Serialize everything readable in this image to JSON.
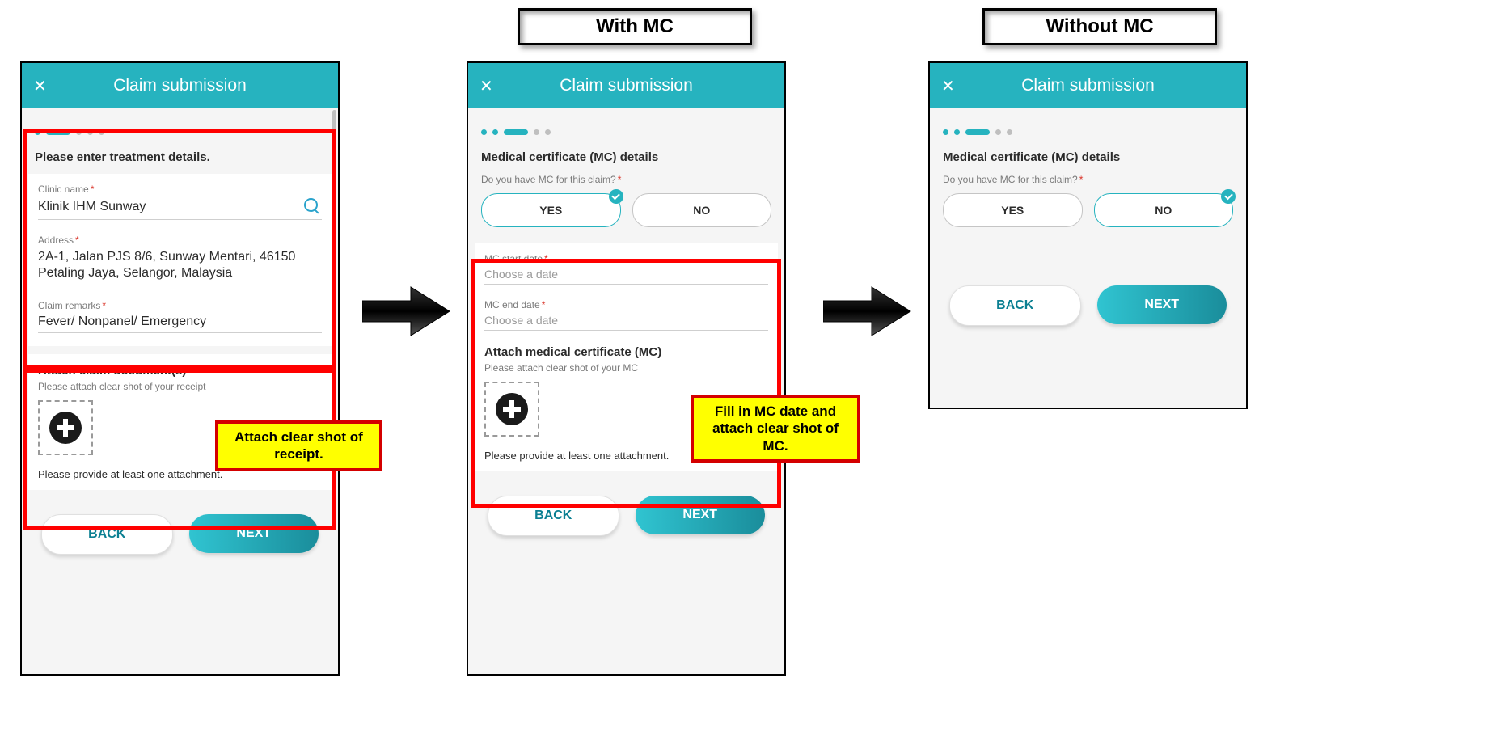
{
  "labels": {
    "with_mc": "With MC",
    "without_mc": "Without MC"
  },
  "header": {
    "title": "Claim submission",
    "close_glyph": "✕"
  },
  "screen1": {
    "heading": "Please enter treatment details.",
    "clinic_label": "Clinic name",
    "clinic_value": "Klinik IHM Sunway",
    "address_label": "Address",
    "address_value": "2A-1, Jalan PJS 8/6, Sunway Mentari, 46150 Petaling Jaya, Selangor, Malaysia",
    "remarks_label": "Claim remarks",
    "remarks_value": "Fever/ Nonpanel/ Emergency",
    "attach_heading": "Attach claim document(s)",
    "attach_sub": "Please attach clear shot of your receipt",
    "attach_min": "Please provide at least one attachment."
  },
  "mc_question": "Do you have MC for this claim?",
  "mc_heading": "Medical certificate (MC) details",
  "seg": {
    "yes": "YES",
    "no": "NO"
  },
  "screen2": {
    "start_label": "MC start date",
    "end_label": "MC end date",
    "choose": "Choose a date",
    "attach_heading": "Attach medical certificate (MC)",
    "attach_sub": "Please attach clear shot of your MC",
    "attach_min": "Please provide at least one attachment."
  },
  "buttons": {
    "back": "BACK",
    "next": "NEXT"
  },
  "callouts": {
    "receipt": "Attach clear shot of receipt.",
    "mc": "Fill in MC date and attach clear shot of MC."
  }
}
